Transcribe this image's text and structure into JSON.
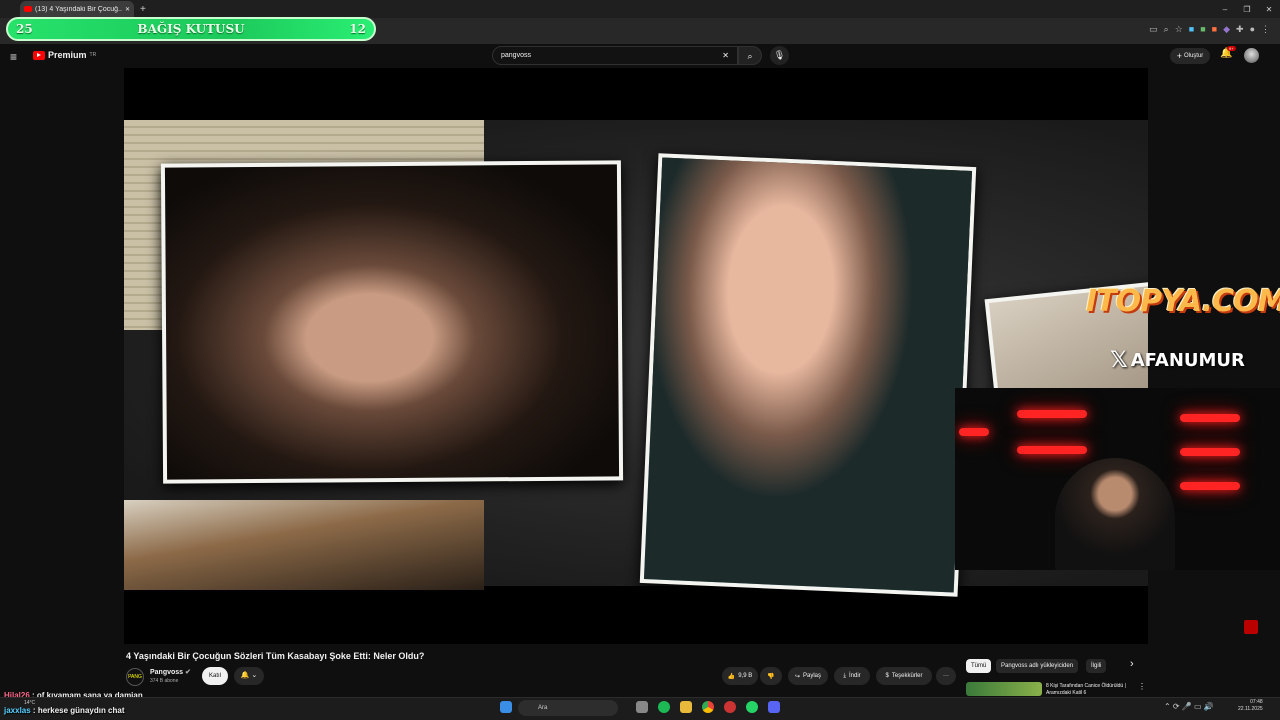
{
  "browser": {
    "tab_title": "(13) 4 Yaşındaki Bir Çocuğ...",
    "win_min": "–",
    "win_max": "❐",
    "win_close": "✕"
  },
  "donation_bar": {
    "left_value": "25",
    "title": "BAĞIŞ KUTUSU",
    "right_value": "12"
  },
  "header": {
    "menu_icon": "≡",
    "logo_text": "Premium",
    "logo_sup": "TR",
    "search_value": "pangvoss",
    "clear_icon": "✕",
    "search_icon": "⌕",
    "mic_icon": "🎙",
    "create_label": "Oluştur",
    "bell_badge": "9+"
  },
  "overlays": {
    "sponsor": "ITOPYA.COM",
    "x_icon": "𝕏",
    "x_handle": "AFANUMUR"
  },
  "video_info": {
    "title": "4 Yaşındaki Bir Çocuğun Sözleri Tüm Kasabayı Şoke Etti: Neler Oldu?",
    "channel_name": "Pangvoss",
    "channel_avatar_text": "PANG",
    "subscribers": "374 B abone",
    "joined_label": "Katıl",
    "bell_label": "🔔 ⌄",
    "like_count": "9,9 B",
    "share_label": "Paylaş",
    "download_label": "İndir",
    "thanks_label": "Teşekkürler",
    "more_label": "···"
  },
  "sidebar": {
    "chips": [
      "Tümü",
      "Pangvoss adlı yükleyiciden",
      "İlgili"
    ],
    "next_icon": "›",
    "rec_title": "8 Kişi Tarafından Canice Öldürüldü | Aramızdaki Katil 6"
  },
  "chat": [
    {
      "user": "Hilal26",
      "message": " : of kıyamam sana ya damian"
    },
    {
      "user": "jaxxlas",
      "message": " : herkese günaydın chat"
    }
  ],
  "taskbar": {
    "weather": "14°C",
    "search_placeholder": "Ara",
    "time": "07:48",
    "date": "22.11.2025"
  }
}
